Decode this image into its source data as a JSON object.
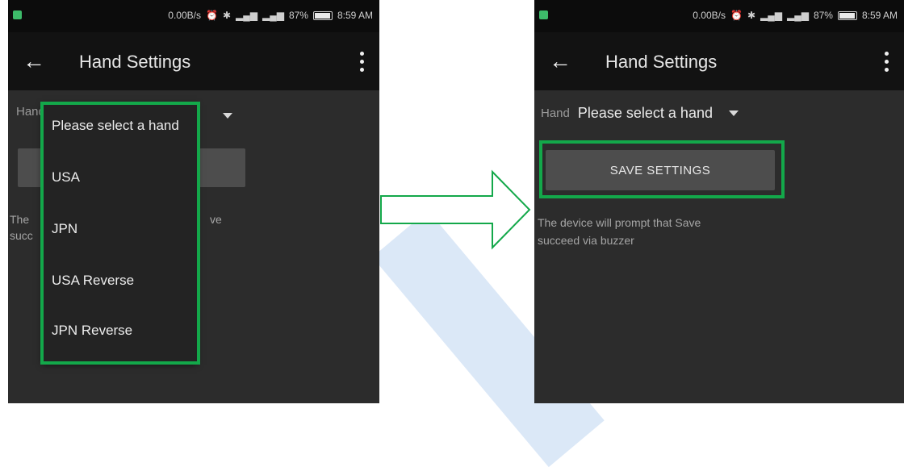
{
  "status": {
    "speed": "0.00B/s",
    "battery": "87%",
    "time": "8:59 AM"
  },
  "appbar": {
    "title": "Hand Settings"
  },
  "form": {
    "hand_label": "Hand",
    "hand_value": "Please select a hand",
    "save_label": "SAVE SETTINGS",
    "info_line1": "The device will prompt that Save",
    "info_line2": "succeed via buzzer",
    "left_info_line1_start": "The",
    "left_info_line1_end": "ve",
    "left_info_line2_start": "succ"
  },
  "dropdown": {
    "options": [
      "Please select a hand",
      "USA",
      "JPN",
      "USA Reverse",
      "JPN Reverse"
    ]
  },
  "colors": {
    "highlight": "#13a84a",
    "statusbar": "#0c0c0c",
    "appbar": "#121212",
    "background": "#2c2c2c",
    "button": "#4d4d4d"
  }
}
